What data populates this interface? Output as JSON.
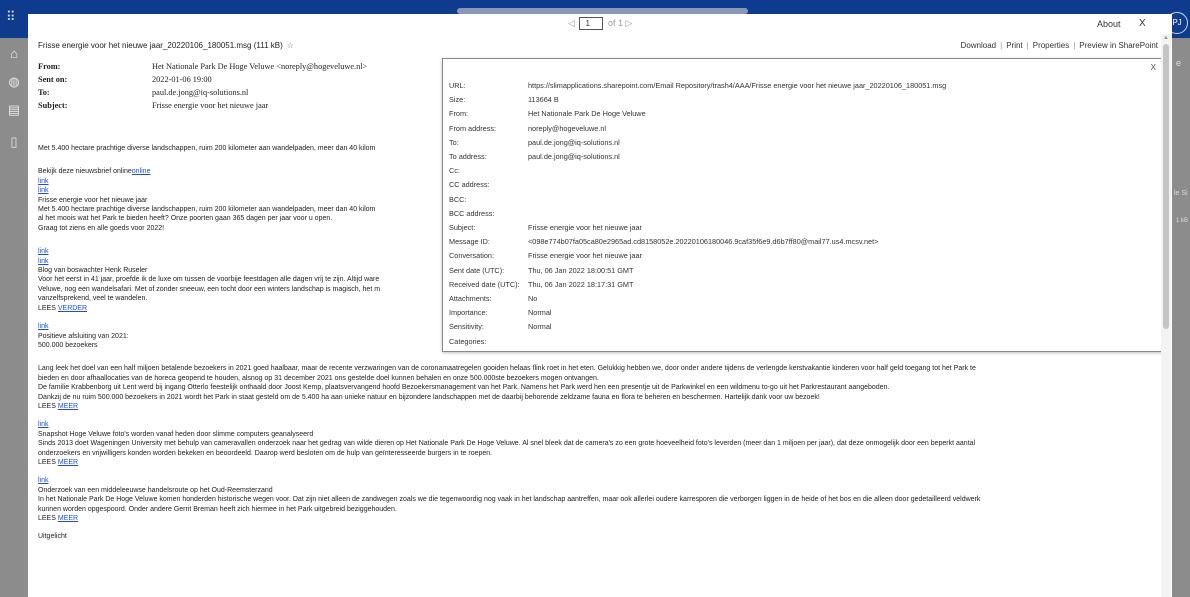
{
  "viewer": {
    "page_current": "1",
    "page_total_label": "of 1",
    "about_label": "About",
    "close_label": "X",
    "file_title": "Frisse energie voor het nieuwe jaar_20220106_180051.msg (111 kB)",
    "star": "☆",
    "actions": [
      "Download",
      "Print",
      "Properties",
      "Preview in SharePoint"
    ]
  },
  "email_header": {
    "from_label": "From:",
    "from_value": "Het Nationale Park De Hoge Veluwe <noreply@hogeveluwe.nl>",
    "sent_label": "Sent on:",
    "sent_value": "2022-01-06 19:00",
    "to_label": "To:",
    "to_value": "paul.de.jong@iq-solutions.nl",
    "subject_label": "Subject:",
    "subject_value": "Frisse energie voor het nieuwe jaar"
  },
  "body": {
    "intro": "Met 5.400 hectare prachtige diverse landschappen, ruim 200 kilometer aan wandelpaden, meer dan 40 kilom",
    "online_prefix": "Bekijk deze nieuwsbrief online",
    "online_link": "online",
    "link": "link",
    "s1_title": "Frisse energie voor het nieuwe jaar",
    "s1_l1": "Met 5.400 hectare prachtige diverse landschappen, ruim 200 kilometer aan wandelpaden, meer dan 40 kilom",
    "s1_l2": "al het moois wat het Park te bieden heeft? Onze poorten gaan 365 dagen per jaar voor u open.",
    "s1_l3": "Graag tot ziens en alle goeds voor 2022!",
    "s2_title": "Blog van boswachter Henk Ruseler",
    "s2_l1": "Voor het eerst in 41 jaar, proefde ik de luxe om tussen de voorbije feestdagen alle dagen vrij te zijn. Altijd ware",
    "s2_l2": "Veluwe, nog een wandelsafari. Met of zonder sneeuw, een tocht door een winters landschap is magisch, het m",
    "s2_l3": "vanzelfsprekend, veel te wandelen.",
    "lees": "LEES",
    "verder": "VERDER",
    "meer": "MEER",
    "s3_title": "Positieve afsluiting van 2021:",
    "s3_sub": "500.000 bezoekers",
    "s3_l1": "Lang leek het doel van een half miljoen betalende bezoekers in 2021 goed haalbaar, maar de recente verzwaringen van de coronamaatregelen gooiden helaas flink roet in het eten. Gelukkig hebben we, door onder andere tijdens de verlengde kerstvakantie kinderen voor half geld toegang tot het Park te",
    "s3_l2": "bieden en door afhaallocaties van de horeca geopend te houden, alsnog op 31 december 2021 ons gestelde doel kunnen behalen en onze 500.000ste bezoekers mogen ontvangen.",
    "s3_l3": "De familie Krabbenborg uit Lent werd bij ingang Otterlo feestelijk onthaald door Joost Kemp, plaatsvervangend hoofd Bezoekersmanagement van het Park. Namens het Park werd hen een presentje uit de Parkwinkel en een wildmenu to-go uit het Parkrestaurant aangeboden.",
    "s3_l4": " Dankzij de nu ruim 500.000 bezoekers in 2021 wordt het Park in staat gesteld om de 5.400 ha aan unieke natuur en bijzondere landschappen met de daarbij behorende zeldzame fauna en flora te beheren en beschermen. Hartelijk dank voor uw bezoek!",
    "s4_title": "Snapshot Hoge Veluwe foto's worden vanaf heden door slimme computers geanalyseerd",
    "s4_l1": "Sinds 2013 doet Wageningen University met behulp van cameravallen onderzoek naar het gedrag van wilde dieren op Het Nationale Park De Hoge Veluwe. Al snel bleek dat de camera's zo een grote hoeveelheid foto's leverden (meer dan 1 miljoen per jaar), dat deze onmogelijk door een beperkt aantal",
    "s4_l2": "onderzoekers en vrijwilligers konden worden bekeken en beoordeeld. Daarop werd besloten om de hulp van geïnteresseerde burgers in te roepen.",
    "s5_title": "Onderzoek van een middeleeuwse handelsroute op het Oud-Reemsterzand",
    "s5_l1": "In het Nationale Park De Hoge Veluwe komen honderden historische wegen voor. Dat zijn niet alleen de zandwegen zoals we die tegenwoordig nog vaak in het landschap aantreffen, maar ook allerlei oudere karresporen die verborgen liggen in de heide of het bos en die alleen door gedetailleerd veldwerk",
    "s5_l2": "kunnen worden opgespoord. Onder andere Gerrit Breman heeft zich hiermee in het Park uitgebreid beziggehouden.",
    "s6_title": "Uitgelicht"
  },
  "properties": {
    "close": "X",
    "rows": [
      {
        "label": "URL:",
        "value": "https://slimapplications.sharepoint.com/Email Repository/trash4/AAA/Frisse energie voor het nieuwe jaar_20220106_180051.msg"
      },
      {
        "label": "Size:",
        "value": "113664 B"
      },
      {
        "label": "From:",
        "value": "Het Nationale Park De Hoge Veluwe"
      },
      {
        "label": "From address:",
        "value": "noreply@hogeveluwe.nl"
      },
      {
        "label": "To:",
        "value": "paul.de.jong@iq-solutions.nl"
      },
      {
        "label": "To address:",
        "value": "paul.de.jong@iq-solutions.nl"
      },
      {
        "label": "Cc:",
        "value": ""
      },
      {
        "label": "CC address:",
        "value": ""
      },
      {
        "label": "BCC:",
        "value": ""
      },
      {
        "label": "BCC address:",
        "value": ""
      },
      {
        "label": "Subject:",
        "value": "Frisse energie voor het nieuwe jaar"
      },
      {
        "label": "Message ID:",
        "value": "<098e774b07fa05ca80e2965ad.cd8158052e.20220106180046.9caf35f6e9.d6b7ff80@mail77.us4.mcsv.net>"
      },
      {
        "label": "Conversation:",
        "value": "Frisse energie voor het nieuwe jaar"
      },
      {
        "label": "Sent date (UTC):",
        "value": "Thu, 06 Jan 2022 18:00:51 GMT"
      },
      {
        "label": "Received date (UTC):",
        "value": "Thu, 06 Jan 2022 18:17:31 GMT"
      },
      {
        "label": "Attachments:",
        "value": "No"
      },
      {
        "label": "Importance:",
        "value": "Normal"
      },
      {
        "label": "Sensitivity:",
        "value": "Normal"
      },
      {
        "label": "Categories:",
        "value": ""
      }
    ]
  },
  "background_fragments": {
    "avatar": "PJ",
    "frag1": "e",
    "frag2": "le Si",
    "frag3": "1 kB"
  }
}
